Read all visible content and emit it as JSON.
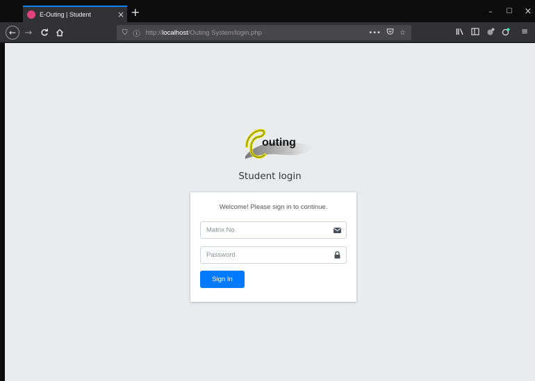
{
  "browser": {
    "tab_title": "E-Outing | Student",
    "tab_close": "×",
    "new_tab": "+",
    "window_controls": {
      "minimize": "–",
      "maximize": "☐",
      "close": "×"
    },
    "url": {
      "scheme": "http://",
      "host": "localhost",
      "path": "/Outing System/login.php"
    },
    "url_actions": {
      "more": "•••"
    },
    "toolbar_icons": [
      "back-icon",
      "forward-icon",
      "reload-icon",
      "home-icon",
      "shield-icon",
      "info-icon",
      "pocket-icon",
      "bookmark-star-icon",
      "library-icon",
      "sidebar-icon",
      "extension-icon",
      "profile-icon",
      "menu-icon"
    ]
  },
  "page": {
    "logo_text": "outing",
    "logo_letter": "e",
    "heading": "Student login",
    "card_message": "Welcome! Please sign in to continue.",
    "matrix_placeholder": "Matrix No.",
    "password_placeholder": "Password",
    "signin_label": "Sign In"
  },
  "colors": {
    "primary": "#007bff",
    "page_bg": "#e9ecef",
    "tab_accent": "#0a84ff",
    "logo_yellow": "#e6e000"
  }
}
